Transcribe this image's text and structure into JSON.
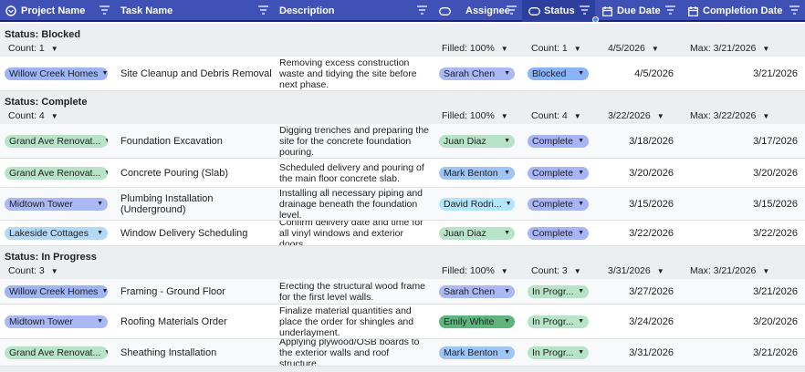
{
  "header": {
    "project": "Project Name",
    "task": "Task Name",
    "description": "Description",
    "assignee": "Assignee",
    "status": "Status",
    "due": "Due Date",
    "completion": "Completion Date"
  },
  "groups": [
    {
      "title": "Status: Blocked",
      "count": "Count: 1",
      "filled": "Filled: 100%",
      "scount": "Count: 1",
      "due": "4/5/2026",
      "max": "Max: 3/21/2026",
      "rows": [
        {
          "project": "Willow Creek Homes",
          "task": "Site Cleanup and Debris Removal",
          "description": "Removing excess construction waste and tidying the site before next phase.",
          "assignee": "Sarah Chen",
          "status": "Blocked",
          "due": "4/5/2026",
          "completion": "3/21/2026"
        }
      ]
    },
    {
      "title": "Status: Complete",
      "count": "Count: 4",
      "filled": "Filled: 100%",
      "scount": "Count: 4",
      "due": "3/22/2026",
      "max": "Max: 3/22/2026",
      "rows": [
        {
          "project": "Grand Ave Renovat...",
          "task": "Foundation Excavation",
          "description": "Digging trenches and preparing the site for the concrete foundation pouring.",
          "assignee": "Juan Diaz",
          "status": "Complete",
          "due": "3/18/2026",
          "completion": "3/17/2026"
        },
        {
          "project": "Grand Ave Renovat...",
          "task": "Concrete Pouring (Slab)",
          "description": "Scheduled delivery and pouring of the main floor concrete slab.",
          "assignee": "Mark Benton",
          "status": "Complete",
          "due": "3/20/2026",
          "completion": "3/20/2026"
        },
        {
          "project": "Midtown Tower",
          "task": "Plumbing Installation (Underground)",
          "description": "Installing all necessary piping and drainage beneath the foundation level.",
          "assignee": "David Rodri...",
          "status": "Complete",
          "due": "3/15/2026",
          "completion": "3/15/2026"
        },
        {
          "project": "Lakeside Cottages",
          "task": "Window Delivery Scheduling",
          "description": "Confirm delivery date and time for all vinyl windows and exterior doors.",
          "assignee": "Juan Diaz",
          "status": "Complete",
          "due": "3/22/2026",
          "completion": "3/22/2026"
        }
      ]
    },
    {
      "title": "Status: In Progress",
      "count": "Count: 3",
      "filled": "Filled: 100%",
      "scount": "Count: 3",
      "due": "3/31/2026",
      "max": "Max: 3/21/2026",
      "rows": [
        {
          "project": "Willow Creek Homes",
          "task": "Framing - Ground Floor",
          "description": "Erecting the structural wood frame for the first level walls.",
          "assignee": "Sarah Chen",
          "status": "In Progr...",
          "due": "3/27/2026",
          "completion": "3/21/2026"
        },
        {
          "project": "Midtown Tower",
          "task": "Roofing Materials Order",
          "description": "Finalize material quantities and place the order for shingles and underlayment.",
          "assignee": "Emily White",
          "status": "In Progr...",
          "due": "3/24/2026",
          "completion": "3/20/2026"
        },
        {
          "project": "Grand Ave Renovat...",
          "task": "Sheathing Installation",
          "description": "Applying plywood/OSB boards to the exterior walls and roof structure.",
          "assignee": "Mark Benton",
          "status": "In Progr...",
          "due": "3/31/2026",
          "completion": "3/21/2026"
        }
      ]
    }
  ],
  "colors": {
    "header": "#3f51b5",
    "blocked": "#8ab4f8",
    "complete": "#a7b4f5",
    "in_progress": "#b7e4c7",
    "willow": "#9fb4f2",
    "grand": "#b7e4c7",
    "midtown": "#aab8f3",
    "lakeside": "#b3d9f7",
    "sarah": "#aab8f3",
    "juan": "#b7e4c7",
    "mark": "#9fc4f6",
    "david": "#b3e5fc",
    "emily": "#5fb67c"
  }
}
